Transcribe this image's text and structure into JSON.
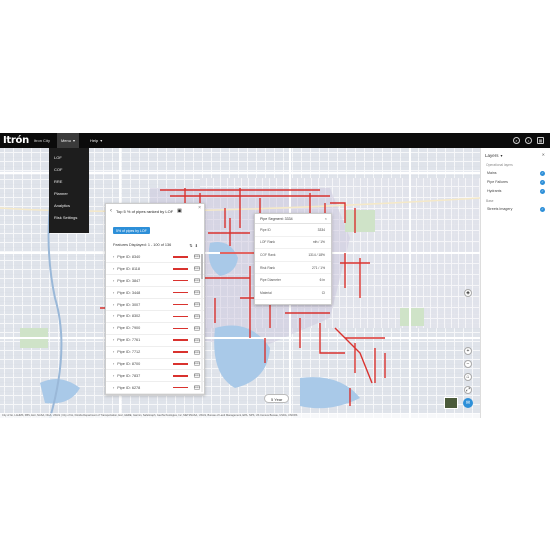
{
  "app": {
    "logo": "Itrón",
    "city": "Itron City"
  },
  "nav": {
    "menu_label": "Menu",
    "help_label": "Help"
  },
  "menu_items": [
    "LOF",
    "COF",
    "RRE",
    "Planner",
    "Analytics",
    "Risk Settings"
  ],
  "panel": {
    "title": "Top 5 % of pipes ranked by LOF",
    "chip": "5% of pipes by LOF",
    "features_label": "Features Displayed: 1 - 100 of 136",
    "pipes": [
      "Pipe ID: 8340",
      "Pipe ID: 8118",
      "Pipe ID: 3847",
      "Pipe ID: 3448",
      "Pipe ID: 3007",
      "Pipe ID: 8302",
      "Pipe ID: 7900",
      "Pipe ID: 7761",
      "Pipe ID: 7712",
      "Pipe ID: 8700",
      "Pipe ID: 7837",
      "Pipe ID: 6278"
    ],
    "zoom_label": "Zoom"
  },
  "popup": {
    "title": "Pipe Segment: 3334",
    "rows": [
      {
        "label": "Pipe ID",
        "value": "3334"
      },
      {
        "label": "LOF Rank",
        "value": "nth / 1%"
      },
      {
        "label": "COF Rank",
        "value": "1314 / 18%"
      },
      {
        "label": "Risk Rank",
        "value": "271 / 1%"
      },
      {
        "label": "Pipe Diameter",
        "value": "6 in"
      },
      {
        "label": "Material",
        "value": "CI"
      }
    ]
  },
  "layers": {
    "title": "Layers",
    "section1": "Operational layers",
    "items": [
      "Mains",
      "Pipe Failures",
      "Hydrants"
    ],
    "section2": "Base",
    "base_items": [
      "Streets Imagery"
    ]
  },
  "scale_label": "5 Year",
  "attribution": "City of Ito, LAHMS, FBS, Esri, NASA, NGA, USGS | City of Ito, Florida Department of Transportation, Esri, HERE, Garmin, SafeGraph, GeoTechnologies, Inc, METI/NASA, USGS, Bureau of Land Management, EPA, NPS, US Census Bureau, USDA, USFWS",
  "colors": {
    "accent": "#2d8fd8",
    "highlight": "#d9322e",
    "topbar": "#0b0b0b"
  }
}
